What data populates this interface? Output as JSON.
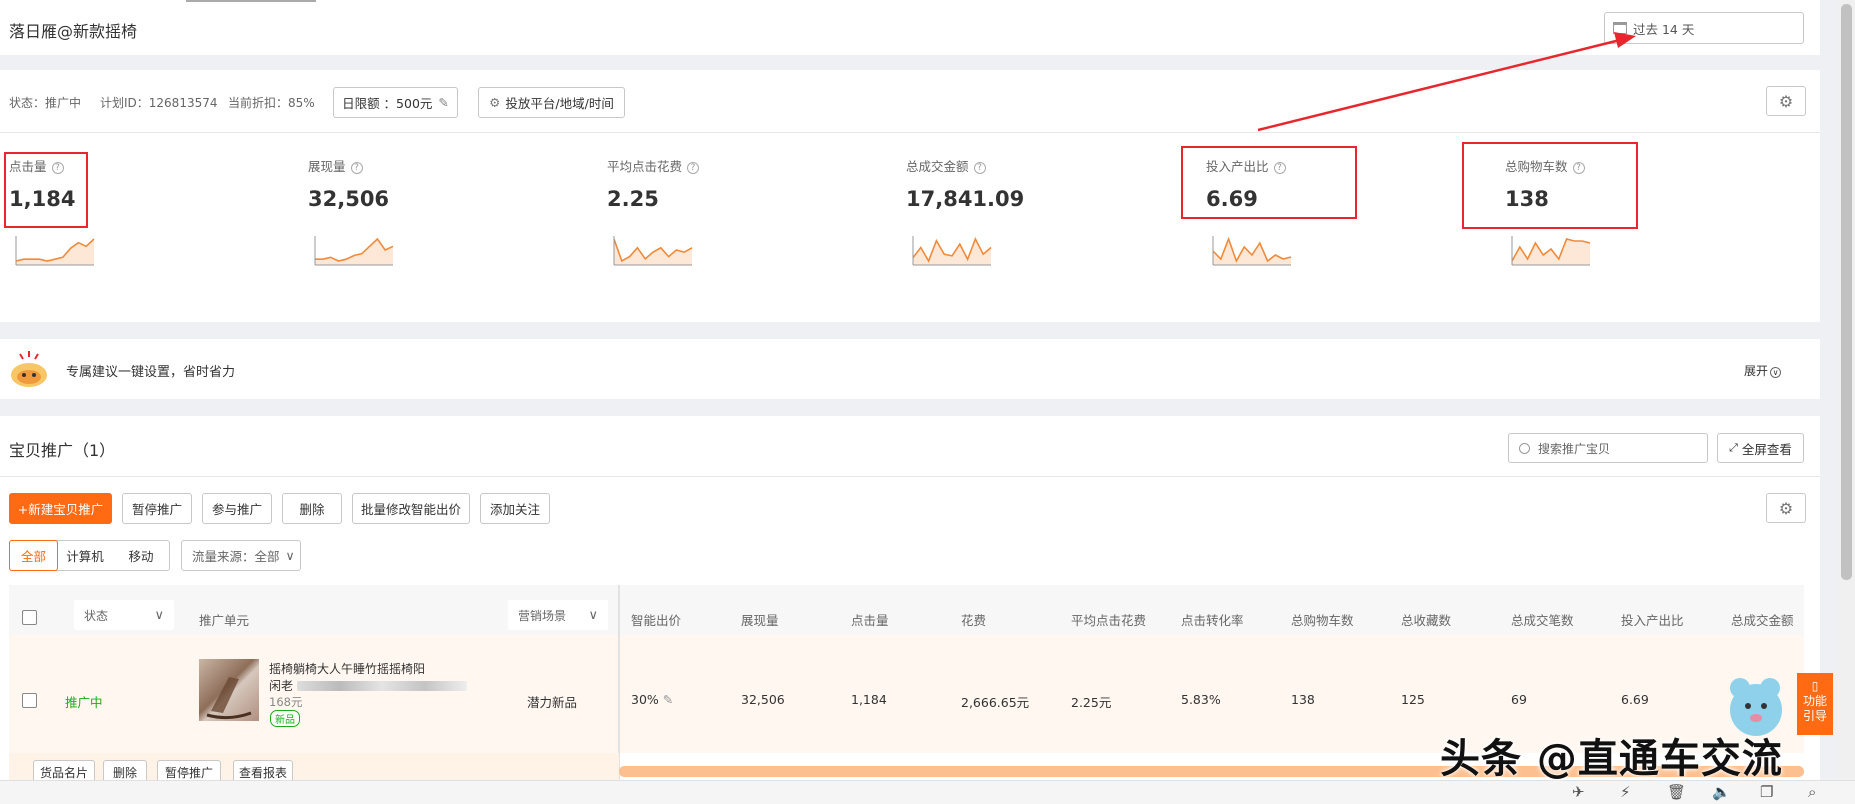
{
  "header": {
    "title": "落日雁@新款摇椅",
    "date_range": "过去 14 天"
  },
  "plan": {
    "status": "状态：推广中",
    "plan_id": "计划ID：126813574",
    "discount": "当前折扣：85%",
    "daily_budget": "日限额 ：500元",
    "platform_button": "投放平台/地域/时间"
  },
  "metrics": [
    {
      "label": "点击量",
      "value": "1,184"
    },
    {
      "label": "展现量",
      "value": "32,506"
    },
    {
      "label": "平均点击花费",
      "value": "2.25"
    },
    {
      "label": "总成交金额",
      "value": "17,841.09"
    },
    {
      "label": "投入产出比",
      "value": "6.69"
    },
    {
      "label": "总购物车数",
      "value": "138"
    }
  ],
  "suggestion": {
    "text": "专属建议一键设置，省时省力",
    "expand": "展开"
  },
  "promo": {
    "title": "宝贝推广（1）",
    "search_placeholder": "搜索推广宝贝",
    "fullscreen": "全屏查看",
    "actions": {
      "new": "+新建宝贝推广",
      "pause": "暂停推广",
      "join": "参与推广",
      "delete": "删除",
      "batch_bid": "批量修改智能出价",
      "follow": "添加关注"
    },
    "device_tabs": [
      "全部",
      "计算机",
      "移动"
    ],
    "traffic_source": "流量来源：全部"
  },
  "table": {
    "headers": {
      "status": "状态",
      "unit": "推广单元",
      "scene": "营销场景",
      "smart_bid": "智能出价",
      "impressions": "展现量",
      "clicks": "点击量",
      "cost": "花费",
      "avg_cpc": "平均点击花费",
      "ctr_conv": "点击转化率",
      "cart": "总购物车数",
      "fav": "总收藏数",
      "orders": "总成交笔数",
      "roi": "投入产出比",
      "gmv": "总成交金额"
    },
    "row": {
      "status": "推广中",
      "title_line1": "摇椅躺椅大人午睡竹摇摇椅阳",
      "title_line2": "闲老",
      "price": "168元",
      "badge": "新品",
      "scene": "潜力新品",
      "smart_bid": "30%",
      "impressions": "32,506",
      "clicks": "1,184",
      "cost": "2,666.65元",
      "avg_cpc": "2.25元",
      "ctr_conv": "5.83%",
      "cart": "138",
      "fav": "125",
      "orders": "69",
      "roi": "6.69"
    },
    "row_actions": [
      "货品名片",
      "删除",
      "暂停推广",
      "查看报表"
    ]
  },
  "side_widget": {
    "label_line1": "功能",
    "label_line2": "引导"
  },
  "watermark": "头条 @直通车交流",
  "colors": {
    "accent": "#ff6a13",
    "annotation": "#e8262e",
    "active_status": "#1aad19"
  },
  "trend_lines": [
    [
      2,
      3,
      3,
      3,
      2,
      3,
      4,
      9,
      12,
      10,
      14
    ],
    [
      3,
      3,
      4,
      2,
      3,
      5,
      6,
      10,
      14,
      8,
      10
    ],
    [
      14,
      4,
      6,
      10,
      5,
      8,
      10,
      6,
      9,
      8,
      10
    ],
    [
      4,
      10,
      2,
      14,
      6,
      5,
      12,
      3,
      15,
      6,
      10
    ],
    [
      8,
      4,
      14,
      3,
      10,
      6,
      12,
      3,
      6,
      4,
      5
    ],
    [
      3,
      10,
      4,
      12,
      6,
      9,
      4,
      14,
      13,
      13,
      12
    ]
  ]
}
